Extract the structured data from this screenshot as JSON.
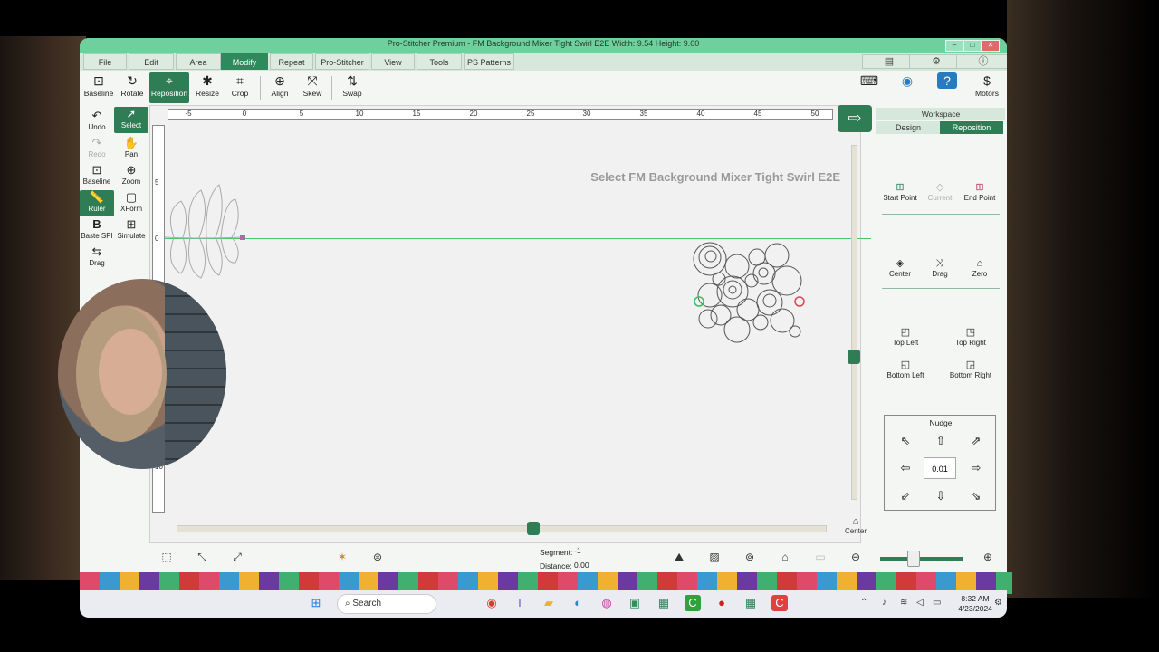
{
  "window": {
    "title": "Pro-Stitcher Premium   -   FM Background Mixer Tight Swirl E2E   Width: 9.54   Height: 9.00"
  },
  "menu": [
    "File",
    "Edit",
    "Area",
    "Modify",
    "Repeat",
    "Pro-Stitcher",
    "View",
    "Tools",
    "PS Patterns"
  ],
  "active_menu": "Modify",
  "toolbar": {
    "baseline": "Baseline",
    "rotate": "Rotate",
    "reposition": "Reposition",
    "resize": "Resize",
    "crop": "Crop",
    "align": "Align",
    "skew": "Skew",
    "swap": "Swap",
    "motors": "Motors"
  },
  "left_tools": {
    "undo": "Undo",
    "select": "Select",
    "redo": "Redo",
    "pan": "Pan",
    "baseline": "Baseline",
    "zoom": "Zoom",
    "ruler": "Ruler",
    "xform": "XForm",
    "baste_spi": "Baste SPI",
    "simulate": "Simulate",
    "drag": "Drag"
  },
  "ruler": {
    "h_ticks": [
      "-5",
      "0",
      "5",
      "10",
      "15",
      "20",
      "25",
      "30",
      "35",
      "40",
      "45",
      "50"
    ],
    "v_ticks": [
      "5",
      "0",
      "10"
    ]
  },
  "canvas": {
    "message": "Select FM Background Mixer Tight Swirl E2E",
    "center_label": "Center"
  },
  "right_panel": {
    "workspace": "Workspace",
    "tabs": [
      "Design",
      "Reposition"
    ],
    "active_tab": "Reposition",
    "start_point": "Start Point",
    "current": "Current",
    "end_point": "End Point",
    "center": "Center",
    "drag": "Drag",
    "zero": "Zero",
    "top_left": "Top Left",
    "top_right": "Top Right",
    "bottom_left": "Bottom Left",
    "bottom_right": "Bottom Right",
    "nudge": "Nudge",
    "nudge_value": "0.01"
  },
  "status": {
    "segment_label": "Segment:",
    "segment_value": "-1",
    "distance_label": "Distance:",
    "distance_value": "0.00"
  },
  "taskbar": {
    "search": "Search",
    "time": "8:32 AM",
    "date": "4/23/2024"
  },
  "colors": {
    "accent": "#2e7d55",
    "title_bar": "#6fcf9d",
    "guide_line": "#4cc46a"
  }
}
